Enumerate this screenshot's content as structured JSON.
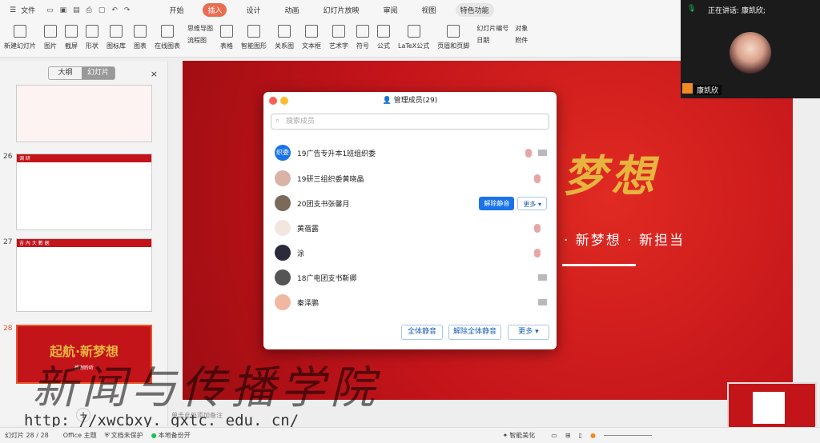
{
  "menubar": {
    "menu": "文件",
    "tabs": [
      "开始",
      "插入",
      "设计",
      "动画",
      "幻灯片放映",
      "审阅",
      "视图",
      "特色功能"
    ],
    "active_tab": "插入"
  },
  "ribbon": {
    "items": [
      "新建幻灯片",
      "图片",
      "截屏",
      "形状",
      "图标库",
      "图表",
      "在线图表",
      "表格",
      "智能图形",
      "关系图",
      "文本框",
      "艺术字",
      "符号",
      "公式",
      "LaTeX公式",
      "页眉和页脚"
    ],
    "stacked": [
      "思维导图",
      "流程图",
      "幻灯片编号",
      "日期",
      "对象",
      "附件"
    ]
  },
  "leftpanel": {
    "tab_outline": "大纲",
    "tab_slides": "幻灯片",
    "slide_numbers": [
      "26",
      "27",
      "28"
    ],
    "slide26_title": "调  研",
    "slide27_title": "吉 內 大 數 据",
    "slide28_title": "起航·新梦想",
    "slide28_sub": "感谢聆听"
  },
  "slide": {
    "title": "梦想",
    "slogan": "· 新梦想 · 新担当"
  },
  "dialog": {
    "title": "管理成员(29)",
    "search_placeholder": "搜索成员",
    "members": [
      {
        "avatar_text": "织委",
        "name": "19广告专升本1班组织委"
      },
      {
        "avatar_text": "",
        "name": "19研三组织委黄晓晶"
      },
      {
        "avatar_text": "",
        "name": "20团支书张馨月"
      },
      {
        "avatar_text": "",
        "name": "黄蓓露"
      },
      {
        "avatar_text": "",
        "name": "涂"
      },
      {
        "avatar_text": "",
        "name": "18广电团支书靳卿"
      },
      {
        "avatar_text": "",
        "name": "秦泽鹏"
      }
    ],
    "unmute_label": "解除静音",
    "more_label": "更多 ▾",
    "footer": {
      "mute_all": "全体静音",
      "unmute_all": "解除全体静音",
      "more": "更多 ▾"
    }
  },
  "video": {
    "speaking": "正在讲话: 康凯欣;",
    "name": "康凯欣"
  },
  "status": {
    "slide_count": "幻灯片 28 / 28",
    "theme": "Office 主题",
    "protect": "文档未保护",
    "backup": "本地备份开",
    "beautify": "智能美化",
    "notes": "单击此处添加备注"
  },
  "watermark": {
    "text": "新闻与传播学院",
    "url": "http: //xwcbxy. gxtc. edu. cn/"
  },
  "colors": {
    "accent": "#ea6d4f",
    "primary": "#1a73e8",
    "slide_red": "#c3141a",
    "gold": "#e7b440"
  }
}
